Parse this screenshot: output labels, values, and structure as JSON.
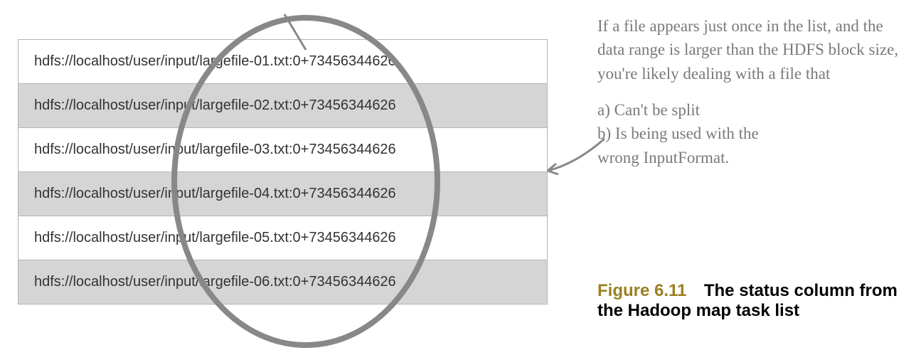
{
  "table": {
    "rows": [
      "hdfs://localhost/user/input/largefile-01.txt:0+73456344626",
      "hdfs://localhost/user/input/largefile-02.txt:0+73456344626",
      "hdfs://localhost/user/input/largefile-03.txt:0+73456344626",
      "hdfs://localhost/user/input/largefile-04.txt:0+73456344626",
      "hdfs://localhost/user/input/largefile-05.txt:0+73456344626",
      "hdfs://localhost/user/input/largefile-06.txt:0+73456344626"
    ]
  },
  "annotation": {
    "intro": "If a file appears just once in the list, and the data range is larger than the HDFS block size, you're likely dealing with a file that",
    "item_a": "a)  Can't be split",
    "item_b": "b)  Is being used with the",
    "item_b_cont": "wrong InputFormat."
  },
  "caption": {
    "label": "Figure 6.11",
    "text": "The status column from the Hadoop map task list"
  }
}
